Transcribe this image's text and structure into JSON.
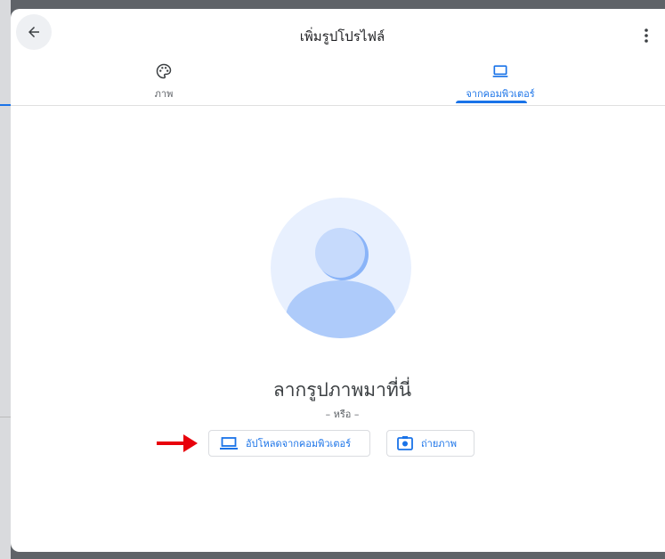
{
  "header": {
    "title": "เพิ่มรูปโปรไฟล์",
    "back_icon": "arrow-left-icon",
    "more_icon": "more-vert-icon"
  },
  "tabs": [
    {
      "label": "ภาพ",
      "icon": "palette-icon",
      "selected": false
    },
    {
      "label": "จากคอมพิวเตอร์",
      "icon": "laptop-icon",
      "selected": true
    }
  ],
  "main": {
    "avatar_icon": "person-placeholder-icon",
    "drop_heading": "ลากรูปภาพมาที่นี่",
    "or_text": "– หรือ –",
    "upload_button": {
      "label": "อัปโหลดจากคอมพิวเตอร์",
      "icon": "laptop-icon"
    },
    "photo_button": {
      "label": "ถ่ายภาพ",
      "icon": "camera-icon"
    }
  },
  "colors": {
    "accent": "#1a73e8",
    "annotation": "#e8000b"
  }
}
